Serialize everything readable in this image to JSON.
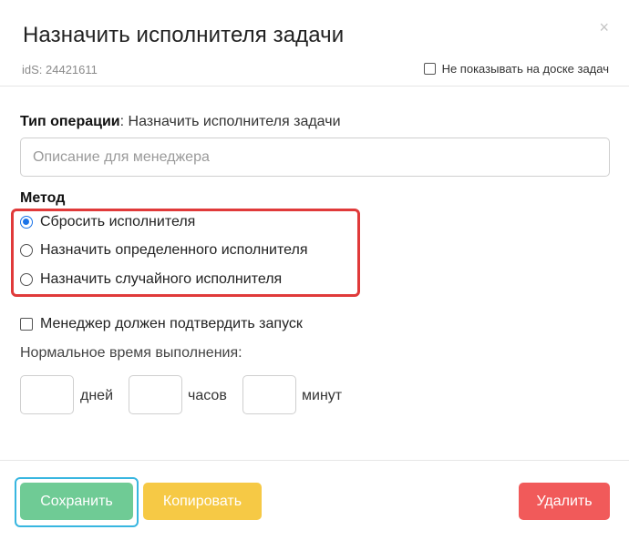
{
  "header": {
    "title": "Назначить исполнителя задачи",
    "close_icon": "×",
    "ids": "idS: 24421611",
    "hide_on_board_label": "Не показывать на доске задач",
    "hide_on_board_checked": false
  },
  "operation": {
    "label": "Тип операции",
    "value": ": Назначить исполнителя задачи"
  },
  "description": {
    "placeholder": "Описание для менеджера",
    "value": ""
  },
  "method": {
    "label": "Метод",
    "options": [
      {
        "label": "Сбросить исполнителя",
        "checked": true
      },
      {
        "label": "Назначить определенного исполнителя",
        "checked": false
      },
      {
        "label": "Назначить случайного исполнителя",
        "checked": false
      }
    ],
    "highlight_color": "#e03a3a"
  },
  "confirm": {
    "label": "Менеджер должен подтвердить запуск",
    "checked": false
  },
  "normal_time": {
    "label": "Нормальное время выполнения:",
    "days_unit": "дней",
    "hours_unit": "часов",
    "minutes_unit": "минут",
    "days": "",
    "hours": "",
    "minutes": ""
  },
  "footer": {
    "save_label": "Сохранить",
    "copy_label": "Копировать",
    "delete_label": "Удалить"
  },
  "colors": {
    "save": "#6fcb95",
    "copy": "#f6c945",
    "delete": "#f15a5a",
    "focus_ring": "#38b6e0"
  }
}
